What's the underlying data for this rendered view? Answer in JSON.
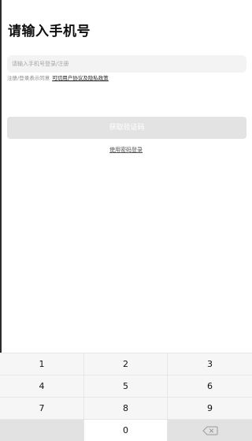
{
  "header": {
    "title": "请输入手机号"
  },
  "form": {
    "phone_placeholder": "请输入手机号登录/注册",
    "phone_value": "",
    "agreement_prefix": "注册/登录表示同意",
    "agreement_link": "可切用户协议及隐私政策",
    "get_code_label": "获取验证码",
    "password_login_label": "使用密码登录"
  },
  "keypad": {
    "keys": [
      "1",
      "2",
      "3",
      "4",
      "5",
      "6",
      "7",
      "8",
      "9",
      "",
      "0",
      ""
    ],
    "backspace_icon": "backspace-icon"
  },
  "colors": {
    "button_disabled": "#e3e3e3",
    "input_background": "#f3f3f3",
    "keypad_background": "#e6e6e6"
  }
}
